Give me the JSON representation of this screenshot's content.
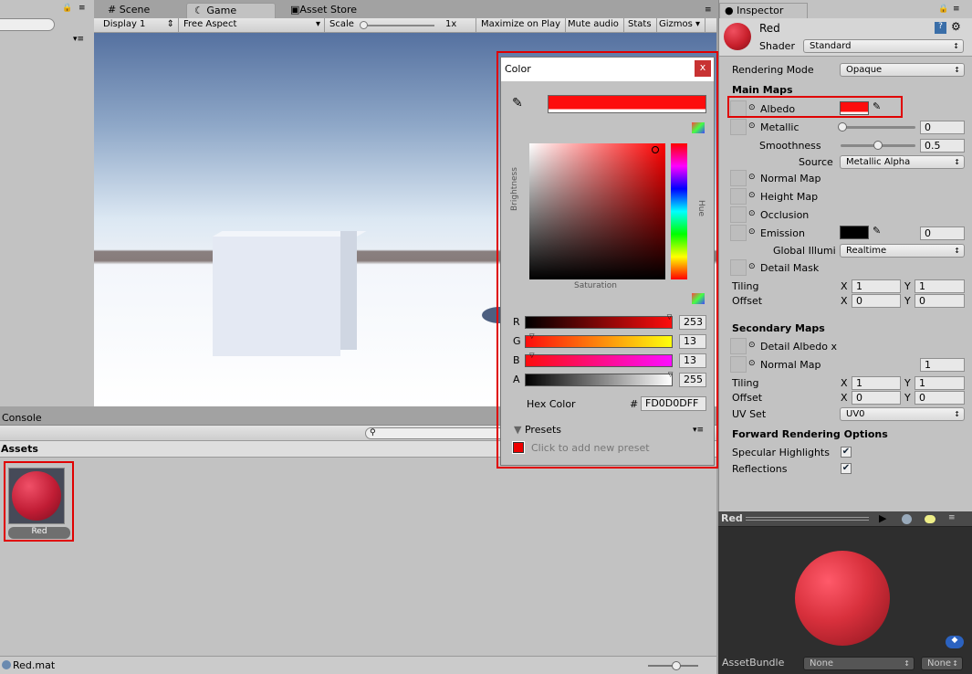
{
  "tabs": {
    "scene": "Scene",
    "game": "Game",
    "asset_store": "Asset Store",
    "inspector": "Inspector",
    "console": "Console"
  },
  "game_toolbar": {
    "display": "Display 1",
    "aspect": "Free Aspect",
    "scale_label": "Scale",
    "scale_value": "1x",
    "maximize": "Maximize on Play",
    "mute": "Mute audio",
    "stats": "Stats",
    "gizmos": "Gizmos"
  },
  "color_picker": {
    "title": "Color",
    "close": "x",
    "brightness": "Brightness",
    "saturation": "Saturation",
    "hue": "Hue",
    "current_color": "#FD0D0D",
    "channels": [
      {
        "label": "R",
        "value": "253"
      },
      {
        "label": "G",
        "value": "13"
      },
      {
        "label": "B",
        "value": "13"
      },
      {
        "label": "A",
        "value": "255"
      }
    ],
    "hex_label": "Hex Color",
    "hash": "#",
    "hex_value": "FD0D0DFF",
    "presets": "Presets",
    "add_preset": "Click to add new preset"
  },
  "project": {
    "assets_header": "Assets",
    "asset_name": "Red",
    "status_file": "Red.mat"
  },
  "inspector": {
    "material_name": "Red",
    "shader_label": "Shader",
    "shader_value": "Standard",
    "rendering_mode_label": "Rendering Mode",
    "rendering_mode": "Opaque",
    "main_maps": "Main Maps",
    "albedo": "Albedo",
    "albedo_color": "#FD0D0D",
    "metallic": "Metallic",
    "metallic_value": "0",
    "metallic_level": 0,
    "smoothness": "Smoothness",
    "smoothness_value": "0.5",
    "smoothness_level": 0.5,
    "source_label": "Source",
    "source_value": "Metallic Alpha",
    "normal_map": "Normal Map",
    "height_map": "Height Map",
    "occlusion": "Occlusion",
    "emission": "Emission",
    "emission_value": "0",
    "gi_label": "Global Illumi",
    "gi_value": "Realtime",
    "detail_mask": "Detail Mask",
    "tiling": "Tiling",
    "offset": "Offset",
    "x": "X",
    "y": "Y",
    "tiling1": {
      "x": "1",
      "y": "1"
    },
    "offset1": {
      "x": "0",
      "y": "0"
    },
    "secondary_maps": "Secondary Maps",
    "detail_albedo": "Detail Albedo x",
    "normal_map2": "Normal Map",
    "normal_map2_value": "1",
    "tiling2": {
      "x": "1",
      "y": "1"
    },
    "offset2": {
      "x": "0",
      "y": "0"
    },
    "uv_set_label": "UV Set",
    "uv_set": "UV0",
    "forward_options": "Forward Rendering Options",
    "specular": "Specular Highlights",
    "specular_checked": true,
    "reflections": "Reflections",
    "reflections_checked": true
  },
  "preview": {
    "title": "Red",
    "assetbundle_label": "AssetBundle",
    "bundle1": "None",
    "bundle2": "None"
  }
}
